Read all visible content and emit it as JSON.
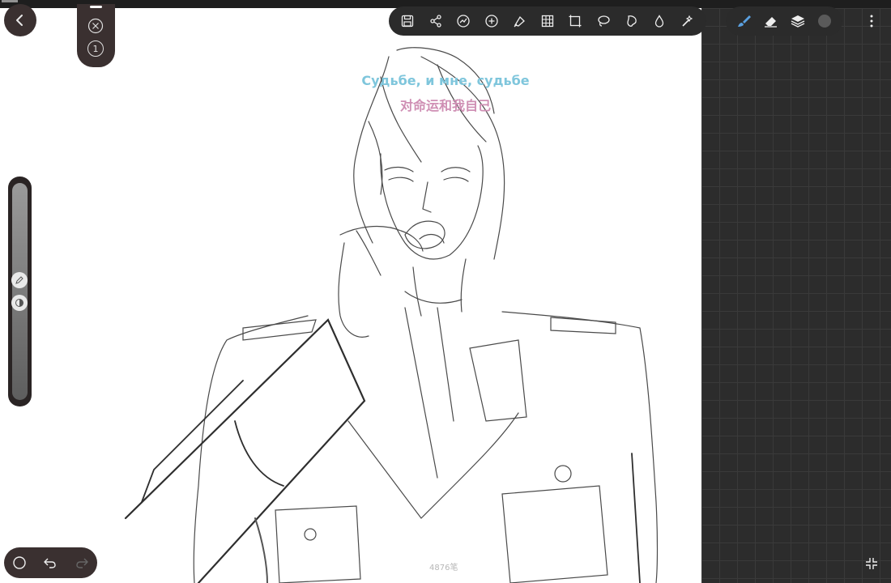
{
  "lyrics": {
    "line_ru": "Судьбе, и мне, судьбе",
    "line_zh": "对命运和我自己"
  },
  "canvas": {
    "stroke_count": "4876笔"
  },
  "side_panel": {
    "layer_number": "1"
  },
  "toolbar": {
    "icons": [
      "save-icon",
      "share-icon",
      "adjust-icon",
      "add-icon",
      "transform-icon",
      "grid-icon",
      "crop-icon",
      "lasso-icon",
      "select-icon",
      "fill-icon",
      "magic-icon"
    ]
  },
  "tools_right": {
    "icons": [
      "brush-icon",
      "eraser-icon",
      "layers-icon",
      "color-icon"
    ],
    "active_color": "#5a5a5a",
    "brush_color": "#5aa0e0"
  }
}
